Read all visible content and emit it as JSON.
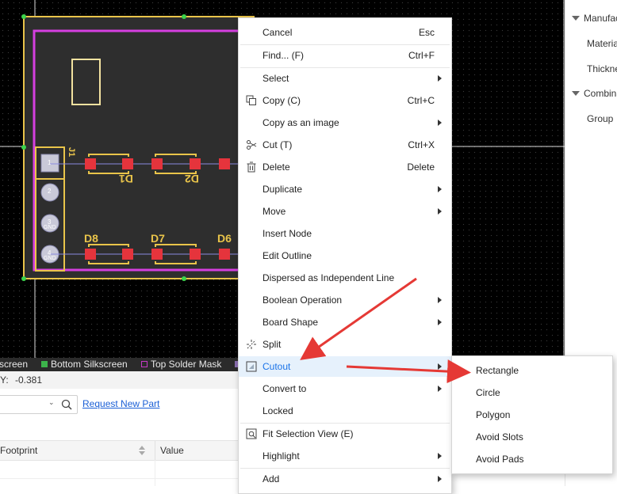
{
  "props_panel": {
    "sections": [
      {
        "label": "Manufac",
        "items": [
          {
            "label": "Materia"
          },
          {
            "label": "Thickne"
          }
        ]
      },
      {
        "label": "Combina",
        "items": [
          {
            "label": "Group"
          }
        ]
      }
    ]
  },
  "pcb": {
    "designators": [
      "D1",
      "D2",
      "D8",
      "D7",
      "D6",
      "J1"
    ],
    "pad_labels": [
      "1",
      "2",
      "3",
      "4"
    ],
    "pad_net": "GND"
  },
  "layer_tabs": [
    {
      "label": "screen",
      "color": "#d9d9d9"
    },
    {
      "label": "Bottom Silkscreen",
      "color": "#3cb44b"
    },
    {
      "label": "Top Solder Mask",
      "color": "#c639c6"
    }
  ],
  "coords": {
    "y_label": "Y:",
    "y_value": "-0.381"
  },
  "library": {
    "request_link": "Request New Part",
    "columns": [
      "Footprint",
      "Value"
    ]
  },
  "context_menu": {
    "items": [
      {
        "label": "Cancel",
        "shortcut": "Esc"
      },
      {
        "label": "Find... (F)",
        "shortcut": "Ctrl+F"
      },
      {
        "label": "Select",
        "shortcut": ""
      },
      {
        "label": "Copy (C)",
        "shortcut": "Ctrl+C",
        "icon": "copy-icon"
      },
      {
        "label": "Copy as an image",
        "shortcut": ""
      },
      {
        "label": "Cut (T)",
        "shortcut": "Ctrl+X",
        "icon": "scissors-icon"
      },
      {
        "label": "Delete",
        "shortcut": "Delete",
        "icon": "trash-icon"
      },
      {
        "label": "Duplicate",
        "shortcut": ""
      },
      {
        "label": "Move",
        "shortcut": ""
      },
      {
        "label": "Insert Node",
        "shortcut": ""
      },
      {
        "label": "Edit Outline",
        "shortcut": ""
      },
      {
        "label": "Dispersed as Independent Line",
        "shortcut": ""
      },
      {
        "label": "Boolean Operation",
        "shortcut": ""
      },
      {
        "label": "Board Shape",
        "shortcut": ""
      },
      {
        "label": "Split",
        "shortcut": "",
        "icon": "split-icon"
      },
      {
        "label": "Cutout",
        "shortcut": "",
        "icon": "cutout-icon"
      },
      {
        "label": "Convert to",
        "shortcut": ""
      },
      {
        "label": "Locked",
        "shortcut": ""
      },
      {
        "label": "Fit Selection View (E)",
        "shortcut": "",
        "icon": "fit-view-icon"
      },
      {
        "label": "Highlight",
        "shortcut": ""
      },
      {
        "label": "Add",
        "shortcut": ""
      }
    ]
  },
  "cutout_submenu": {
    "items": [
      {
        "label": "Rectangle"
      },
      {
        "label": "Circle"
      },
      {
        "label": "Polygon"
      },
      {
        "label": "Avoid Slots"
      },
      {
        "label": "Avoid Pads"
      }
    ]
  },
  "colors": {
    "board_outline": "#e9c44a",
    "keepout": "#d53fe0",
    "pad": "#e5343c",
    "annotation_arrow": "#e53935",
    "menu_highlight": "#e6f1fc",
    "link": "#1a5fd6"
  }
}
